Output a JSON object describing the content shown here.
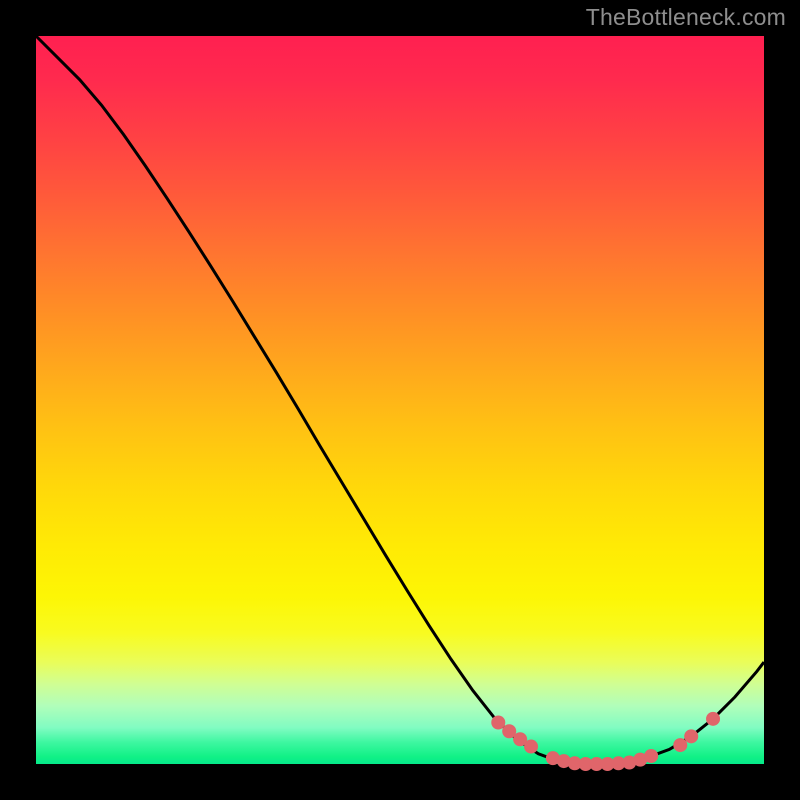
{
  "watermark": "TheBottleneck.com",
  "chart_data": {
    "type": "line",
    "title": "",
    "xlabel": "",
    "ylabel": "",
    "xlim": [
      0,
      100
    ],
    "ylim": [
      0,
      100
    ],
    "series": [
      {
        "name": "curve",
        "x": [
          0,
          3,
          6,
          9,
          12,
          15,
          18,
          21,
          24,
          27,
          30,
          33,
          36,
          39,
          42,
          45,
          48,
          51,
          54,
          57,
          60,
          63,
          66,
          69,
          72,
          75,
          78,
          81,
          84,
          87,
          90,
          93,
          96,
          99,
          100
        ],
        "y": [
          100,
          97,
          94,
          90.5,
          86.5,
          82.2,
          77.7,
          73.1,
          68.4,
          63.6,
          58.7,
          53.8,
          48.8,
          43.7,
          38.7,
          33.7,
          28.7,
          23.8,
          19.0,
          14.4,
          10.1,
          6.3,
          3.4,
          1.4,
          0.3,
          0.0,
          0.0,
          0.2,
          0.9,
          2.0,
          3.8,
          6.2,
          9.2,
          12.7,
          14.0
        ]
      }
    ],
    "markers": {
      "name": "highlight-points",
      "color": "#e0656a",
      "x": [
        63.5,
        65,
        66.5,
        68,
        71,
        72.5,
        74,
        75.5,
        77,
        78.5,
        80,
        81.5,
        83,
        84.5,
        88.5,
        90,
        93
      ],
      "y": [
        5.7,
        4.5,
        3.4,
        2.4,
        0.8,
        0.4,
        0.1,
        0.0,
        0.0,
        0.0,
        0.1,
        0.2,
        0.6,
        1.1,
        2.6,
        3.8,
        6.2
      ]
    },
    "gradient": {
      "top_color": "#ff2050",
      "mid_color": "#ffe000",
      "bottom_color": "#05ea8a"
    }
  }
}
